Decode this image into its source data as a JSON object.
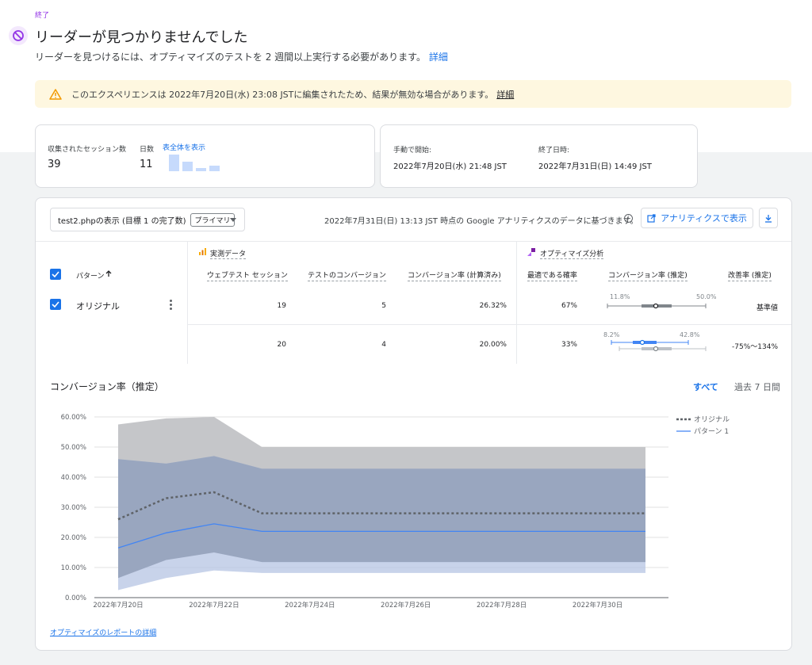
{
  "status": {
    "label": "終了"
  },
  "header": {
    "title": "リーダーが見つかりませんでした",
    "subtitle": "リーダーを見つけるには、オプティマイズのテストを 2 週間以上実行する必要があります。",
    "details_link": "詳細"
  },
  "warning": {
    "text": "このエクスペリエンスは 2022年7月20日(水) 23:08 JSTに編集されたため、結果が無効な場合があります。",
    "details_link": "詳細"
  },
  "summary": {
    "sessions_label": "収集されたセッション数",
    "sessions_value": "39",
    "days_label": "日数",
    "days_value": "11",
    "show_all_link": "表全体を表示",
    "start_label": "手動で開始:",
    "start_value": "2022年7月20日(水) 21:48 JST",
    "end_label": "終了日時:",
    "end_value": "2022年7月31日(日) 14:49 JST"
  },
  "toolbar": {
    "objective_selector": "test2.phpの表示 (目標 1 の完了数)",
    "primary_badge": "プライマリ",
    "data_note": "2022年7月31日(日) 13:13 JST 時点の Google アナリティクスのデータに基づきます。",
    "analytics_button": "アナリティクスで表示"
  },
  "table": {
    "observed_section": "実測データ",
    "optimize_section": "オプティマイズ分析",
    "pattern_header": "パターン",
    "columns": [
      "ウェブテスト セッション",
      "テストのコンバージョン",
      "コンバージョン率 (計算済み)",
      "最適である確率",
      "コンバージョン率 (推定)",
      "改善率 (推定)"
    ],
    "rows": [
      {
        "name": "オリジナル",
        "sessions": "19",
        "conversions": "5",
        "rate": "26.32%",
        "probability": "67%",
        "ci_low": "11.8%",
        "ci_high": "50.0%",
        "improvement": "基準値"
      },
      {
        "name": "",
        "sessions": "20",
        "conversions": "4",
        "rate": "20.00%",
        "probability": "33%",
        "ci_low": "8.2%",
        "ci_high": "42.8%",
        "improvement": "-75%～134%"
      }
    ]
  },
  "chart_section": {
    "title": "コンバージョン率（推定）",
    "range_all": "すべて",
    "range_7d": "過去 7 日間",
    "report_link": "オプティマイズのレポートの詳細"
  },
  "chart_data": {
    "type": "area",
    "x": [
      "2022-07-20",
      "2022-07-21",
      "2022-07-22",
      "2022-07-23",
      "2022-07-24",
      "2022-07-25",
      "2022-07-26",
      "2022-07-27",
      "2022-07-28",
      "2022-07-29",
      "2022-07-30",
      "2022-07-31"
    ],
    "tick_labels": [
      "2022年7月20日",
      "2022年7月22日",
      "2022年7月24日",
      "2022年7月26日",
      "2022年7月28日",
      "2022年7月30日"
    ],
    "y_ticks": [
      "0.00%",
      "10.00%",
      "20.00%",
      "30.00%",
      "40.00%",
      "50.00%",
      "60.00%"
    ],
    "ylim": [
      0,
      60
    ],
    "series": [
      {
        "name": "オリジナル",
        "style": "dotted",
        "color": "#5f6368",
        "values": [
          26,
          33,
          35,
          28,
          28,
          28,
          28,
          28,
          28,
          28,
          28,
          28
        ],
        "upper": [
          57.5,
          59.5,
          60,
          50,
          50,
          50,
          50,
          50,
          50,
          50,
          50,
          50
        ],
        "lower": [
          6.5,
          12.5,
          15,
          11.8,
          11.8,
          11.8,
          11.8,
          11.8,
          11.8,
          11.8,
          11.8,
          11.8
        ]
      },
      {
        "name": "パターン 1",
        "style": "solid",
        "color": "#4285f4",
        "values": [
          16.5,
          21.5,
          24.5,
          22,
          22,
          22,
          22,
          22,
          22,
          22,
          22,
          22
        ],
        "upper": [
          46,
          44.5,
          47,
          42.8,
          42.8,
          42.8,
          42.8,
          42.8,
          42.8,
          42.8,
          42.8,
          42.8
        ],
        "lower": [
          2.5,
          6.5,
          9,
          8.2,
          8.2,
          8.2,
          8.2,
          8.2,
          8.2,
          8.2,
          8.2,
          8.2
        ]
      }
    ],
    "legend_position": "top-right",
    "grid": true
  },
  "colors": {
    "accent": "#1a73e8",
    "status_purple": "#9334e6",
    "warning_bg": "#fef7e0",
    "warning_icon": "#f29900"
  }
}
